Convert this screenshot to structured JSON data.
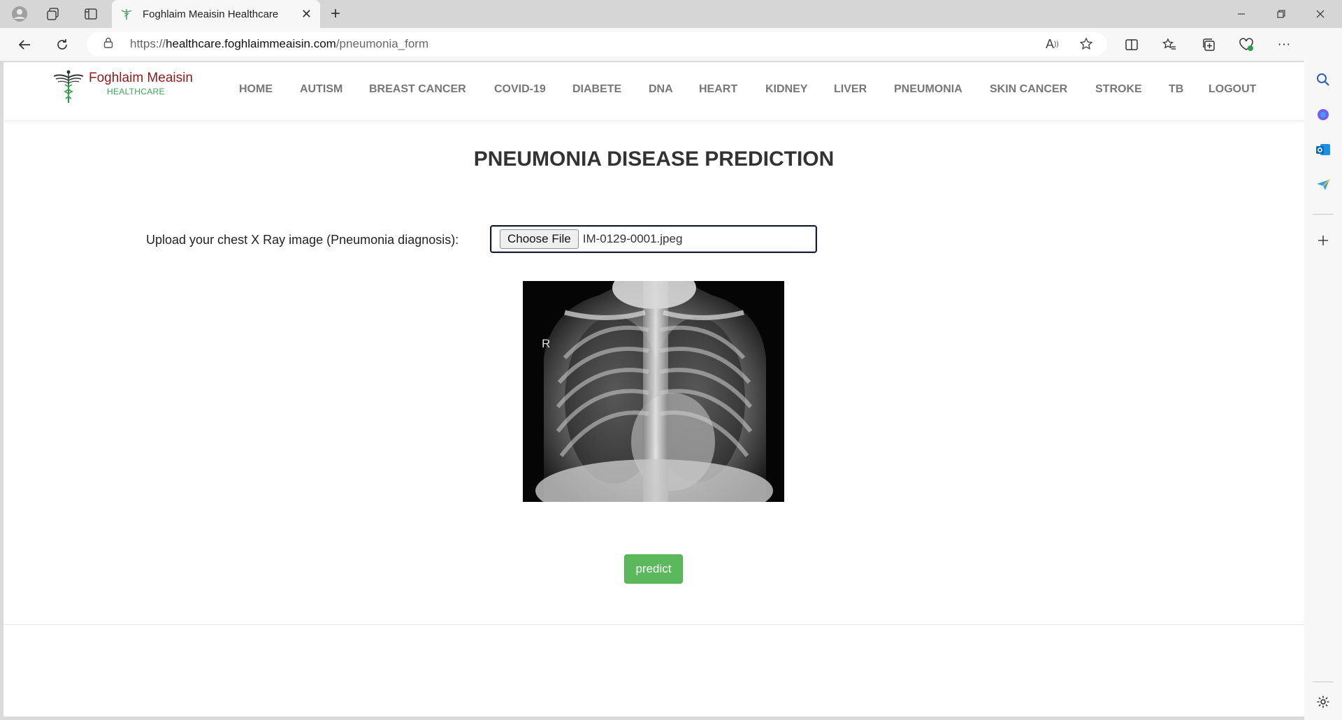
{
  "browser": {
    "tab_title": "Foghlaim Meaisin Healthcare",
    "url_prefix": "https://",
    "url_domain": "healthcare.foghlaimmeaisin.com",
    "url_path": "/pneumonia_form"
  },
  "site": {
    "logo_name": "Foghlaim Meaisin",
    "logo_sub": "HEALTHCARE",
    "nav": [
      "HOME",
      "AUTISM",
      "BREAST CANCER",
      "COVID-19",
      "DIABETE",
      "DNA",
      "HEART",
      "KIDNEY",
      "LIVER",
      "PNEUMONIA",
      "SKIN CANCER",
      "STROKE",
      "TB",
      "LOGOUT"
    ]
  },
  "form": {
    "title": "PNEUMONIA DISEASE PREDICTION",
    "upload_label": "Upload your chest X Ray image (Pneumonia diagnosis):",
    "choose_file_label": "Choose File",
    "file_name": "IM-0129-0001.jpeg",
    "xray_marker": "R",
    "predict_label": "predict"
  },
  "colors": {
    "logo_name": "#8b1a1a",
    "logo_sub": "#3aa655",
    "predict_button": "#5cb85c",
    "nav_text": "#777777"
  }
}
